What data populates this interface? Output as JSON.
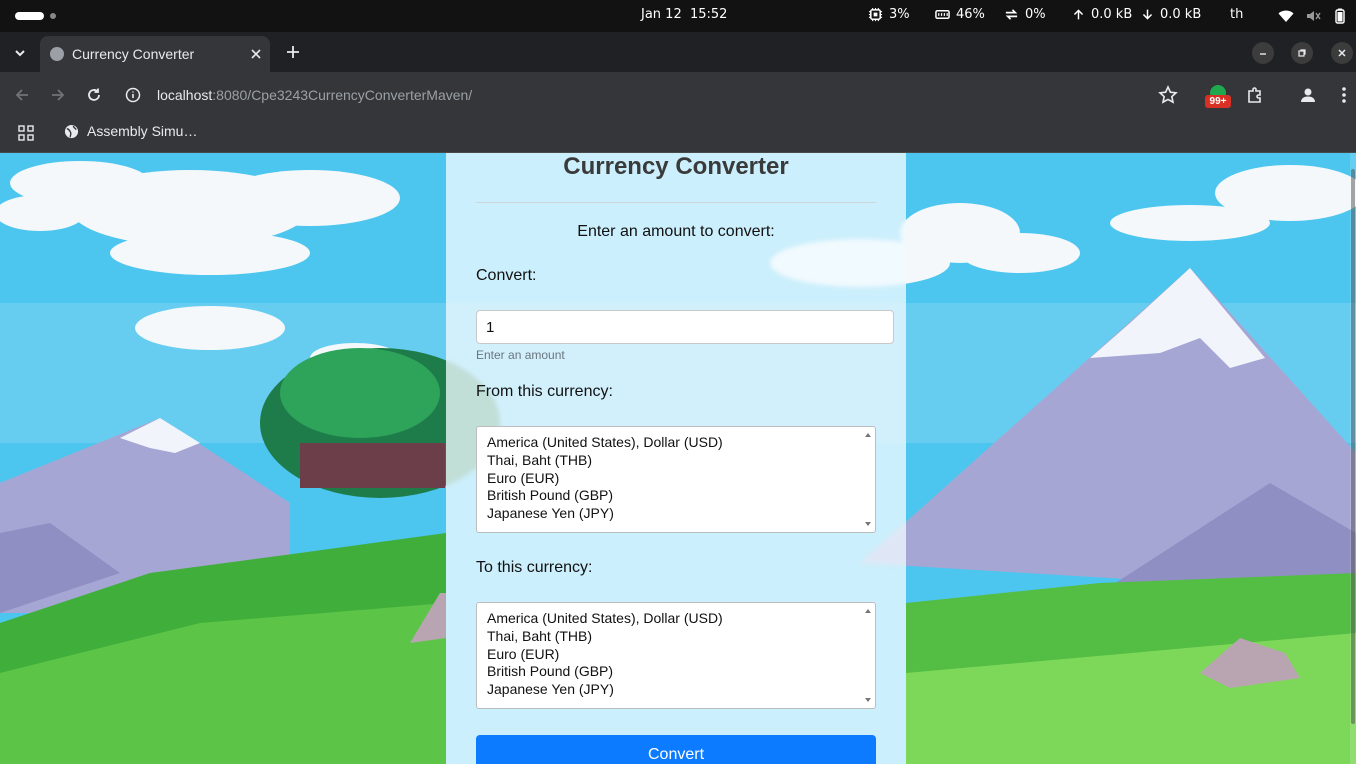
{
  "os_bar": {
    "date": "Jan 12",
    "time": "15:52",
    "cpu": "3%",
    "memory": "46%",
    "swap": "0%",
    "upload": "0.0 kB",
    "download": "0.0 kB",
    "language": "th"
  },
  "browser": {
    "tab_title": "Currency Converter",
    "url_host": "localhost",
    "url_rest": ":8080/Cpe3243CurrencyConverterMaven/",
    "extension_badge": "99+",
    "bookmarks": [
      {
        "label": "Assembly Simu…"
      }
    ]
  },
  "page": {
    "title": "Currency Converter",
    "lead": "Enter an amount to convert:",
    "convert_label": "Convert:",
    "amount_value": "1",
    "amount_help": "Enter an amount",
    "from_label": "From this currency:",
    "to_label": "To this currency:",
    "currencies": [
      "America (United States), Dollar (USD)",
      "Thai, Baht (THB)",
      "Euro (EUR)",
      "British Pound (GBP)",
      "Japanese Yen (JPY)"
    ],
    "convert_button": "Convert"
  },
  "colors": {
    "primary_button": "#0d7bff",
    "sky": "#4cc3ee",
    "grass": "#3fae3a"
  }
}
